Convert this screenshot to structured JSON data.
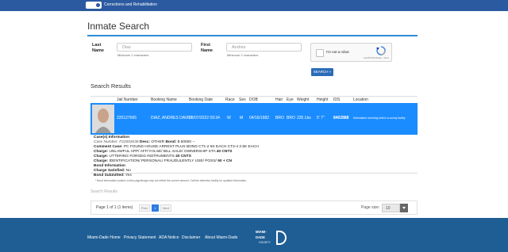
{
  "topbar": {
    "department": "Corrections and Rehabilitation"
  },
  "page": {
    "title": "Inmate Search"
  },
  "form": {
    "last_name_label_1": "Last",
    "last_name_label_2": "Name",
    "last_name_value": "Diaz",
    "last_name_hint": "Minimum 2 characters",
    "first_name_label_1": "First",
    "first_name_label_2": "Name",
    "first_name_value": "Andres",
    "first_name_hint": "Minimum 2 characters",
    "captcha_label": "I'm not a robot",
    "captcha_small": "reCAPTCHA  Privacy · Terms",
    "search_label": "SEARCH »"
  },
  "results": {
    "heading": "Search Results",
    "columns": [
      "Jail Number",
      "Booking Name",
      "Booking Date",
      "Race",
      "Sex",
      "DOB",
      "Hair",
      "Eye",
      "Weight",
      "Height",
      "IDS",
      "Location"
    ],
    "row": {
      "jail_number": "220127665",
      "booking_name": "DIAZ, ANDRES DAVID",
      "booking_date": "08/07/2022 09:34",
      "race": "W",
      "sex": "M",
      "dob": "04/16/1982",
      "hair": "BRO",
      "eye": "BRO",
      "weight": "235 Lbs",
      "height": "5' 7\"",
      "ids": "8402888",
      "location": "Defendants not being held in a county facility"
    },
    "details": {
      "case_header": "Case(s) Information",
      "case_number_label": "Case Number:",
      "case_number_value": "F22004038",
      "desc_label": "Desc:",
      "desc_value": "OTHER",
      "bond_label": "Bond:",
      "bond_value": "$ 50000 --",
      "comment_label": "Comment Case:",
      "comment_value": "PC FOUND HOUSE ARREST PLUS BOND CT1-2 5K EACH CT3-4 2.5K EACH",
      "charge_label": "Charge:",
      "charge1_value": "UNLAWFUL APP/ AFF/ FALSE/ BILL SALE/ OWNERSHIP STA",
      "charge1_cnt": "40 CNTS",
      "charge2_value": "UTTERING FORGED INSTRUMENTS",
      "charge2_cnt": "40 CNTS",
      "charge3_value": "IDENTIFICATION/ PERSONAL/ FRAUDULENTLY USE/ POSS/",
      "charge3_cnt": "50 + CN",
      "bond_header": "Bond Information",
      "charge_satisfied_label": "Charge Satisfied:",
      "charge_satisfied_value": "No",
      "bond_submitted_label": "Bond Submitted:",
      "bond_submitted_value": "Yes",
      "note": "* Bond information posted on this page/image may not reflect the current amount. Call the detention facility for updated information."
    },
    "bottom_label": "Search Results"
  },
  "pager": {
    "info": "Page 1 of 1 (1 items)",
    "prev": "Prev",
    "current": "1",
    "next": "Next",
    "size_label": "Page size:",
    "size_value": "10"
  },
  "footer": {
    "links": [
      "Miami-Dade Home",
      "Privacy Statement",
      "ADA Notice",
      "Disclaimer",
      "About Miami-Dade"
    ],
    "logo_line1": "MIAMI-",
    "logo_line2": "DADE",
    "logo_line3": "COUNTY"
  },
  "colors": {
    "brand_blue": "#2b5aa0",
    "row_highlight": "#1a8cff",
    "accent_rule": "#2e8bd4",
    "footer": "#1f5e94"
  }
}
